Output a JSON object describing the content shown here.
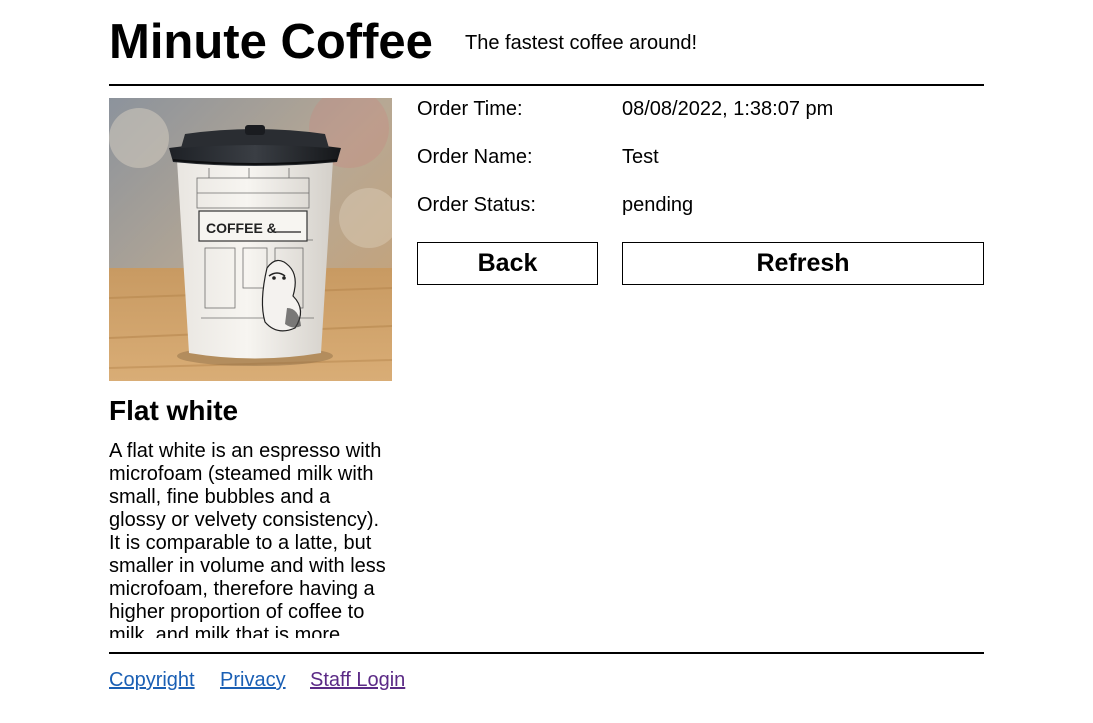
{
  "header": {
    "brand": "Minute Coffee",
    "tagline": "The fastest coffee around!"
  },
  "product": {
    "image_alt": "paper coffee cup",
    "cup_label": "COFFEE &",
    "name": "Flat white",
    "description": "A flat white is an espresso with microfoam (steamed milk with small, fine bubbles and a glossy or velvety consistency). It is comparable to a latte, but smaller in volume and with less microfoam, therefore having a higher proportion of coffee to milk, and milk that is more"
  },
  "order": {
    "time_label": "Order Time:",
    "time_value": "08/08/2022, 1:38:07 pm",
    "name_label": "Order Name:",
    "name_value": "Test",
    "status_label": "Order Status:",
    "status_value": "pending"
  },
  "actions": {
    "back_label": "Back",
    "refresh_label": "Refresh"
  },
  "footer": {
    "copyright_label": "Copyright",
    "privacy_label": "Privacy",
    "staff_login_label": "Staff Login"
  }
}
